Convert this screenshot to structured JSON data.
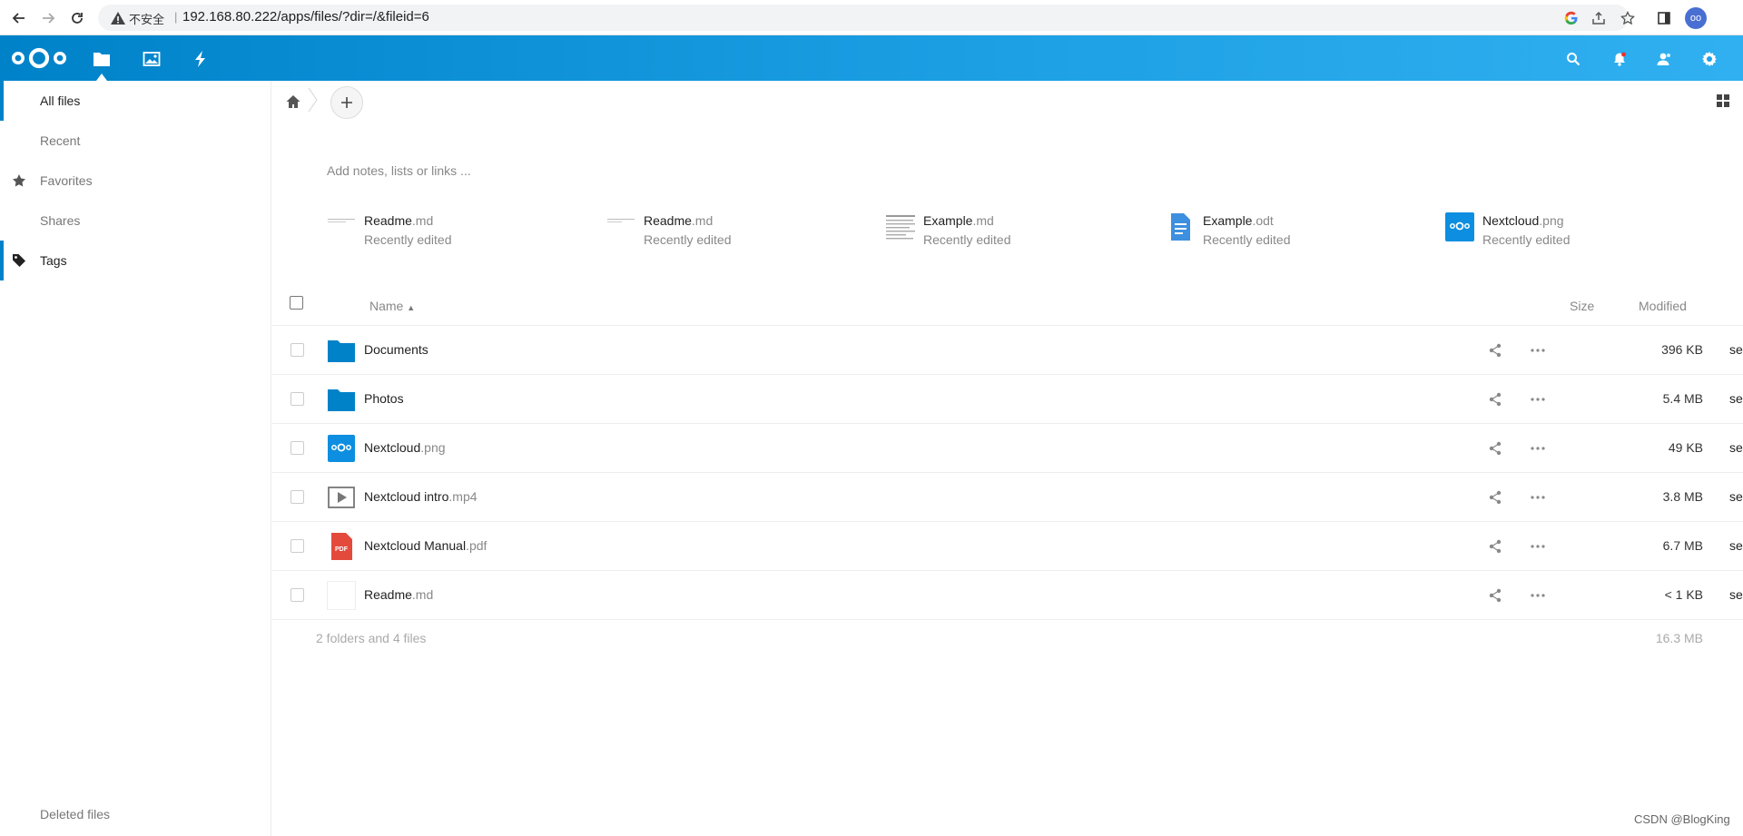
{
  "browser": {
    "insecure_label": "不安全",
    "url": "192.168.80.222/apps/files/?dir=/&fileid=6",
    "avatar_text": "oo"
  },
  "header": {
    "apps": [
      "files-icon",
      "photos-icon",
      "activity-icon"
    ],
    "right_icons": [
      "search-icon",
      "bell-icon",
      "contacts-icon",
      "settings-icon"
    ]
  },
  "sidebar": {
    "items": [
      {
        "label": "All files",
        "icon": ""
      },
      {
        "label": "Recent",
        "icon": ""
      },
      {
        "label": "Favorites",
        "icon": "star-icon"
      },
      {
        "label": "Shares",
        "icon": ""
      },
      {
        "label": "Tags",
        "icon": "tag-icon"
      }
    ],
    "footer": "Deleted files"
  },
  "notes": {
    "placeholder": "Add notes, lists or links ..."
  },
  "recent": [
    {
      "name": "Readme",
      "ext": ".md",
      "sub": "Recently edited"
    },
    {
      "name": "Readme",
      "ext": ".md",
      "sub": "Recently edited"
    },
    {
      "name": "Example",
      "ext": ".md",
      "sub": "Recently edited"
    },
    {
      "name": "Example",
      "ext": ".odt",
      "sub": "Recently edited"
    },
    {
      "name": "Nextcloud",
      "ext": ".png",
      "sub": "Recently edited"
    }
  ],
  "list": {
    "headers": {
      "name": "Name",
      "size": "Size",
      "modified": "Modified"
    },
    "rows": [
      {
        "name": "Documents",
        "ext": "",
        "size": "396 KB",
        "modified": "seconds ago",
        "type": "folder"
      },
      {
        "name": "Photos",
        "ext": "",
        "size": "5.4 MB",
        "modified": "seconds ago",
        "type": "folder"
      },
      {
        "name": "Nextcloud",
        "ext": ".png",
        "size": "49 KB",
        "modified": "seconds ago",
        "type": "image"
      },
      {
        "name": "Nextcloud intro",
        "ext": ".mp4",
        "size": "3.8 MB",
        "modified": "seconds ago",
        "type": "video"
      },
      {
        "name": "Nextcloud Manual",
        "ext": ".pdf",
        "size": "6.7 MB",
        "modified": "seconds ago",
        "type": "pdf"
      },
      {
        "name": "Readme",
        "ext": ".md",
        "size": "< 1 KB",
        "modified": "seconds ago",
        "type": "text"
      }
    ],
    "summary": "2 folders and 4 files",
    "total_size": "16.3 MB"
  },
  "pdf_badge": "PDF",
  "watermark": "CSDN @BlogKing",
  "colors": {
    "brand": "#0082c9",
    "folder": "#0082c9",
    "pdf": "#e34a3c"
  }
}
